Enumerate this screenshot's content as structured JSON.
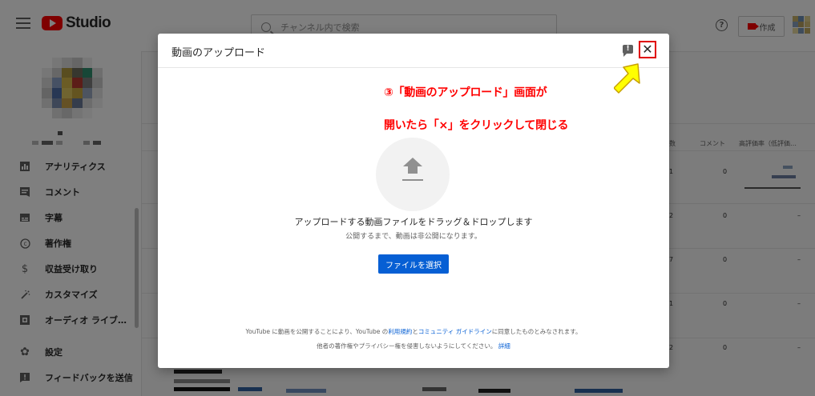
{
  "topbar": {
    "logo_text": "Studio",
    "search_placeholder": "チャンネル内で検索",
    "create_label": "作成"
  },
  "sidebar": {
    "items": [
      {
        "label": "アナリティクス",
        "icon": "analytics-icon"
      },
      {
        "label": "コメント",
        "icon": "comment-icon"
      },
      {
        "label": "字幕",
        "icon": "subtitles-icon"
      },
      {
        "label": "著作権",
        "icon": "copyright-icon"
      },
      {
        "label": "収益受け取り",
        "icon": "dollar-icon"
      },
      {
        "label": "カスタマイズ",
        "icon": "magic-wand-icon"
      },
      {
        "label": "オーディオ ライブ…",
        "icon": "audio-library-icon"
      },
      {
        "label": "設定",
        "icon": "gear-icon"
      },
      {
        "label": "フィードバックを送信",
        "icon": "feedback-icon"
      }
    ]
  },
  "table": {
    "headers": {
      "likes_abbrev": "数",
      "comments": "コメント",
      "like_ratio": "高評価率（低評価…"
    },
    "rows": [
      {
        "views_tail": "1",
        "comments": "0",
        "ratio": ""
      },
      {
        "views_tail": "2",
        "comments": "0",
        "ratio": "–"
      },
      {
        "views_tail": "7",
        "comments": "0",
        "ratio": "–"
      },
      {
        "views_tail": "1",
        "comments": "0",
        "ratio": "–"
      },
      {
        "views_tail": "2",
        "comments": "0",
        "ratio": "–"
      }
    ]
  },
  "dialog": {
    "title": "動画のアップロード",
    "drop_text": "アップロードする動画ファイルをドラッグ＆ドロップします",
    "drop_sub": "公開するまで、動画は非公開になります。",
    "select_button": "ファイルを選択",
    "terms_prefix": "YouTube に動画を公開することにより、YouTube の",
    "terms_link1": "利用規約",
    "terms_and": "と",
    "terms_link2": "コミュニティ ガイドライン",
    "terms_suffix": "に同意したものとみなされます。",
    "terms2_prefix": "他者の著作権やプライバシー権を侵害しないようにしてください。",
    "terms2_link": "詳細"
  },
  "annotation": {
    "line1": "③「動画のアップロード」画面が",
    "line2": "開いたら「×」をクリックして閉じる",
    "color": "#ff0000",
    "arrow_color": "#ffff00"
  },
  "colors": {
    "brand_red": "#ff0000",
    "primary_blue": "#065fd4",
    "close_highlight": "#e00000"
  }
}
